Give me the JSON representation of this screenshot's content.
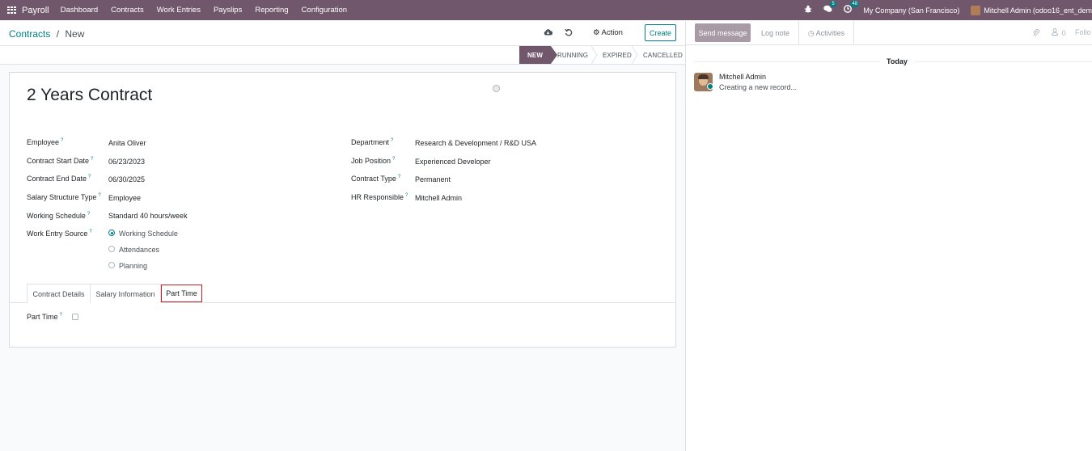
{
  "navbar": {
    "app_name": "Payroll",
    "menu": [
      "Dashboard",
      "Contracts",
      "Work Entries",
      "Payslips",
      "Reporting",
      "Configuration"
    ],
    "chat_badge": "5",
    "activity_badge": "48",
    "company": "My Company (San Francisco)",
    "user": "Mitchell Admin (odoo16_ent_dem"
  },
  "control": {
    "breadcrumb_parent": "Contracts",
    "breadcrumb_sep": "/",
    "breadcrumb_current": "New",
    "action_label": "Action",
    "create_label": "Create"
  },
  "statusbar": {
    "stages": [
      "NEW",
      "RUNNING",
      "EXPIRED",
      "CANCELLED"
    ],
    "active": "NEW"
  },
  "form": {
    "title": "2 Years Contract",
    "left_fields": [
      {
        "label": "Employee",
        "value": "Anita Oliver"
      },
      {
        "label": "Contract Start Date",
        "value": "06/23/2023"
      },
      {
        "label": "Contract End Date",
        "value": "06/30/2025"
      },
      {
        "label": "Salary Structure Type",
        "value": "Employee"
      },
      {
        "label": "Working Schedule",
        "value": "Standard 40 hours/week"
      },
      {
        "label": "Work Entry Source",
        "value": ""
      }
    ],
    "work_entry_options": [
      "Working Schedule",
      "Attendances",
      "Planning"
    ],
    "work_entry_selected": "Working Schedule",
    "right_fields": [
      {
        "label": "Department",
        "value": "Research & Development / R&D USA"
      },
      {
        "label": "Job Position",
        "value": "Experienced Developer"
      },
      {
        "label": "Contract Type",
        "value": "Permanent"
      },
      {
        "label": "HR Responsible",
        "value": "Mitchell Admin"
      }
    ],
    "tabs": [
      "Contract Details",
      "Salary Information",
      "Part Time"
    ],
    "active_tab": "Part Time",
    "part_time_label": "Part Time",
    "part_time_checked": false,
    "help_mark": "?"
  },
  "chatter": {
    "send_message": "Send message",
    "log_note": "Log note",
    "activities": "Activities",
    "follow": "Follo",
    "followers_count": "0",
    "date_separator": "Today",
    "messages": [
      {
        "author": "Mitchell Admin",
        "body": "Creating a new record..."
      }
    ]
  }
}
